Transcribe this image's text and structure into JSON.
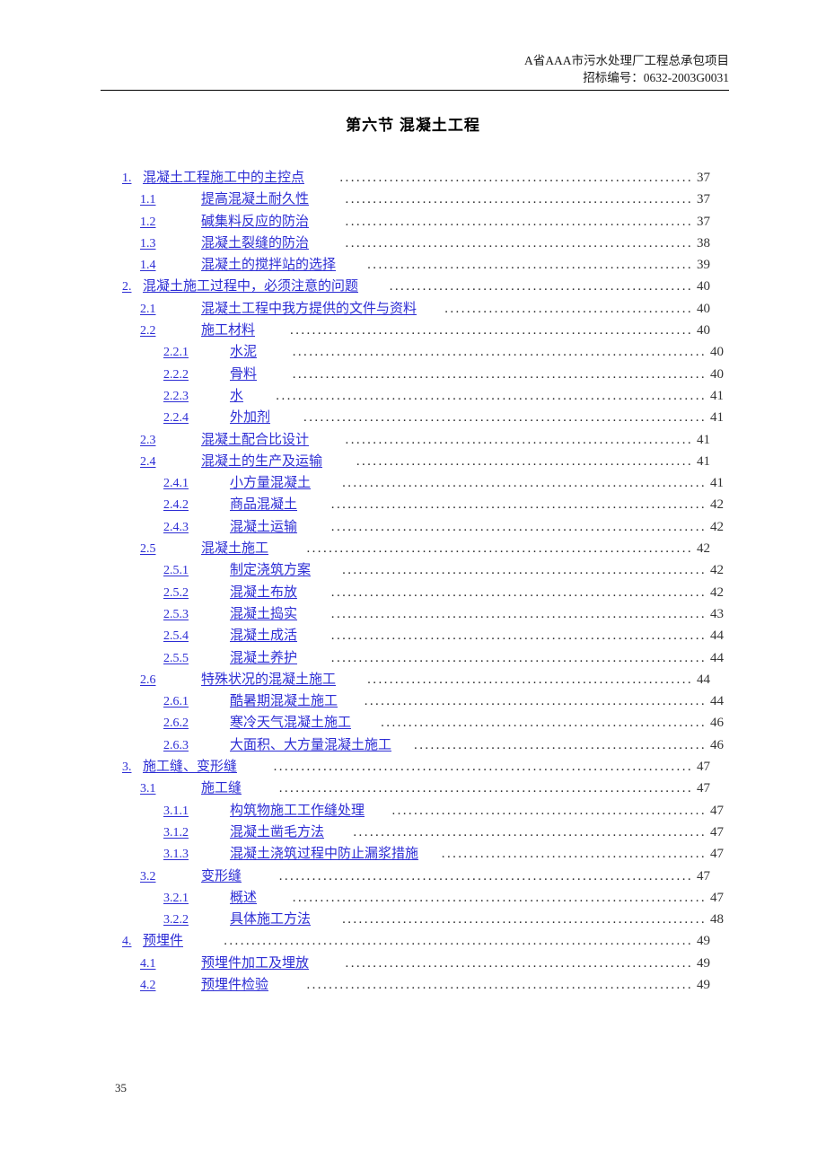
{
  "header": {
    "project_title": "A省AAA市污水处理厂工程总承包项目",
    "tender_number": "招标编号：0632-2003G0031"
  },
  "document": {
    "title": "第六节  混凝土工程",
    "footer_page_number": "35"
  },
  "toc": {
    "entries": [
      {
        "level": 1,
        "number": "1.",
        "label": "混凝土工程施工中的主控点",
        "page": "37",
        "underline": true
      },
      {
        "level": 2,
        "number": "1.1",
        "label": "提高混凝土耐久性",
        "page": "37",
        "underline": true
      },
      {
        "level": 2,
        "number": "1.2",
        "label": "碱集料反应的防治",
        "page": "37",
        "underline": true
      },
      {
        "level": 2,
        "number": "1.3",
        "label": "混凝土裂缝的防治",
        "page": "38",
        "underline": true
      },
      {
        "level": 2,
        "number": "1.4",
        "label": "混凝土的搅拌站的选择",
        "page": "39",
        "underline": true
      },
      {
        "level": 1,
        "number": "2.",
        "label": "混凝土施工过程中，必须注意的问题",
        "page": "40",
        "underline": true
      },
      {
        "level": 2,
        "number": "2.1",
        "label": "混凝土工程中我方提供的文件与资料",
        "page": "40",
        "underline": true
      },
      {
        "level": 2,
        "number": "2.2",
        "label": "施工材料",
        "page": "40",
        "underline": true
      },
      {
        "level": 3,
        "number": "2.2.1",
        "label": "水泥",
        "page": "40",
        "underline": true
      },
      {
        "level": 3,
        "number": "2.2.2",
        "label": "骨料",
        "page": "40",
        "underline": true
      },
      {
        "level": 3,
        "number": "2.2.3",
        "label": "水",
        "page": "41",
        "underline": true
      },
      {
        "level": 3,
        "number": "2.2.4",
        "label": "外加剂",
        "page": "41",
        "underline": true
      },
      {
        "level": 2,
        "number": "2.3",
        "label": "混凝土配合比设计",
        "page": "41",
        "underline": true
      },
      {
        "level": 2,
        "number": "2.4",
        "label": "混凝土的生产及运输",
        "page": "41",
        "underline": true
      },
      {
        "level": 3,
        "number": "2.4.1",
        "label": "小方量混凝土",
        "page": "41",
        "underline": true
      },
      {
        "level": 3,
        "number": "2.4.2",
        "label": "商品混凝土",
        "page": "42",
        "underline": true
      },
      {
        "level": 3,
        "number": "2.4.3",
        "label": "混凝土运输",
        "page": "42",
        "underline": true
      },
      {
        "level": 2,
        "number": "2.5",
        "label": "混凝土施工",
        "page": "42",
        "underline": true
      },
      {
        "level": 3,
        "number": "2.5.1",
        "label": "制定浇筑方案",
        "page": "42",
        "underline": true
      },
      {
        "level": 3,
        "number": "2.5.2",
        "label": "混凝土布放",
        "page": "42",
        "underline": true
      },
      {
        "level": 3,
        "number": "2.5.3",
        "label": "混凝土捣实",
        "page": "43",
        "underline": true
      },
      {
        "level": 3,
        "number": "2.5.4",
        "label": "混凝土成活",
        "page": "44",
        "underline": true
      },
      {
        "level": 3,
        "number": "2.5.5",
        "label": "混凝土养护",
        "page": "44",
        "underline": true
      },
      {
        "level": 2,
        "number": "2.6",
        "label": "特殊状况的混凝土施工",
        "page": "44",
        "underline": true
      },
      {
        "level": 3,
        "number": "2.6.1",
        "label": "酷暑期混凝土施工",
        "page": "44",
        "underline": true
      },
      {
        "level": 3,
        "number": "2.6.2",
        "label": "寒冷天气混凝土施工",
        "page": "46",
        "underline": true
      },
      {
        "level": 3,
        "number": "2.6.3",
        "label": "大面积、大方量混凝土施工",
        "page": "46",
        "underline": true
      },
      {
        "level": 1,
        "number": "3.",
        "label": "施工缝、变形缝",
        "page": "47",
        "underline": true
      },
      {
        "level": 2,
        "number": "3.1",
        "label": "施工缝",
        "page": "47",
        "underline": true
      },
      {
        "level": 3,
        "number": "3.1.1",
        "label": "构筑物施工工作缝处理",
        "page": "47",
        "underline": true
      },
      {
        "level": 3,
        "number": "3.1.2",
        "label": "混凝土凿毛方法",
        "page": "47",
        "underline": true
      },
      {
        "level": 3,
        "number": "3.1.3",
        "label": "混凝土浇筑过程中防止漏浆措施",
        "page": "47",
        "underline": true
      },
      {
        "level": 2,
        "number": "3.2",
        "label": "变形缝",
        "page": "47",
        "underline": true
      },
      {
        "level": 3,
        "number": "3.2.1",
        "label": "概述",
        "page": "47",
        "underline": true
      },
      {
        "level": 3,
        "number": "3.2.2",
        "label": "具体施工方法",
        "page": "48",
        "underline": true
      },
      {
        "level": 1,
        "number": "4.",
        "label": "预埋件",
        "page": "49",
        "underline": true
      },
      {
        "level": 2,
        "number": "4.1",
        "label": "预埋件加工及埋放",
        "page": "49",
        "underline": true
      },
      {
        "level": 2,
        "number": "4.2",
        "label": "预埋件检验",
        "page": "49",
        "underline": true
      }
    ]
  },
  "colors": {
    "link": "#2c2cd4",
    "text": "#000000",
    "leader": "#2b2b2b"
  }
}
